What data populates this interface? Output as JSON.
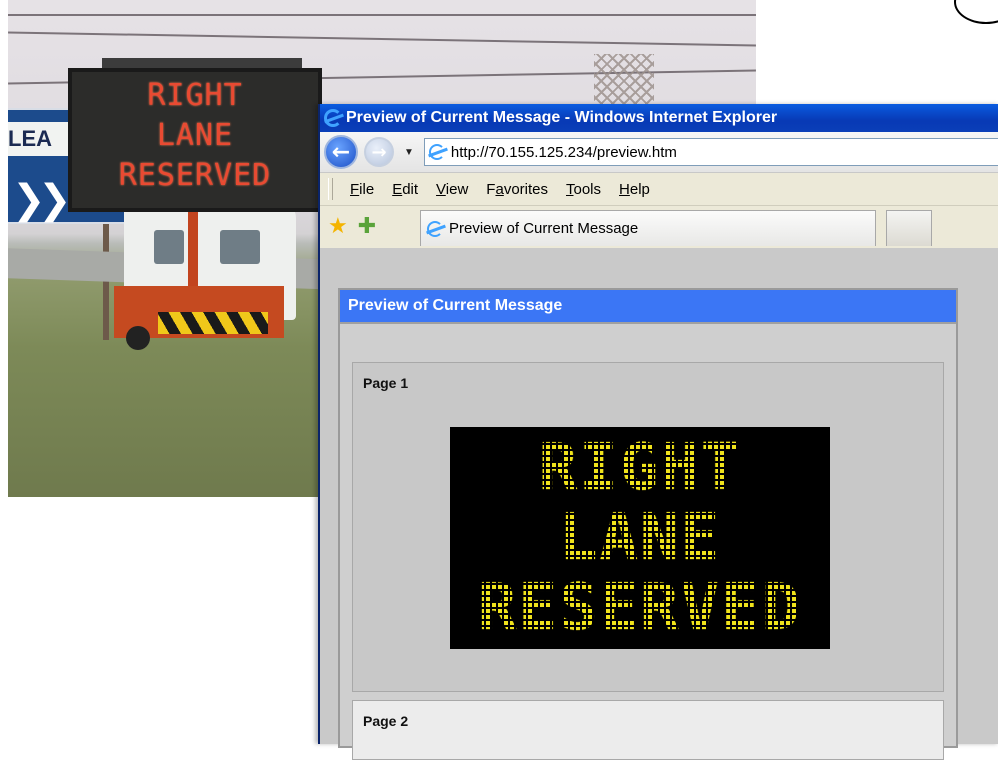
{
  "photo": {
    "road_sign_text": "LEA",
    "vms_sign_lines": [
      "RIGHT",
      "LANE",
      "RESERVED"
    ]
  },
  "browser": {
    "title": "Preview of Current Message - Windows Internet Explorer",
    "address": "http://70.155.125.234/preview.htm",
    "menus": [
      "File",
      "Edit",
      "View",
      "Favorites",
      "Tools",
      "Help"
    ],
    "tab_label": "Preview of Current Message"
  },
  "page": {
    "panel_title": "Preview of Current Message",
    "page1_label": "Page 1",
    "page2_label": "Page 2",
    "led_lines": [
      "RIGHT",
      "LANE",
      "RESERVED"
    ],
    "led_color": "#f0e31c",
    "header_color": "#3b76f5"
  },
  "icons": [
    "back-icon",
    "forward-icon",
    "ie-logo-icon",
    "favorites-star-icon",
    "add-favorite-icon"
  ]
}
